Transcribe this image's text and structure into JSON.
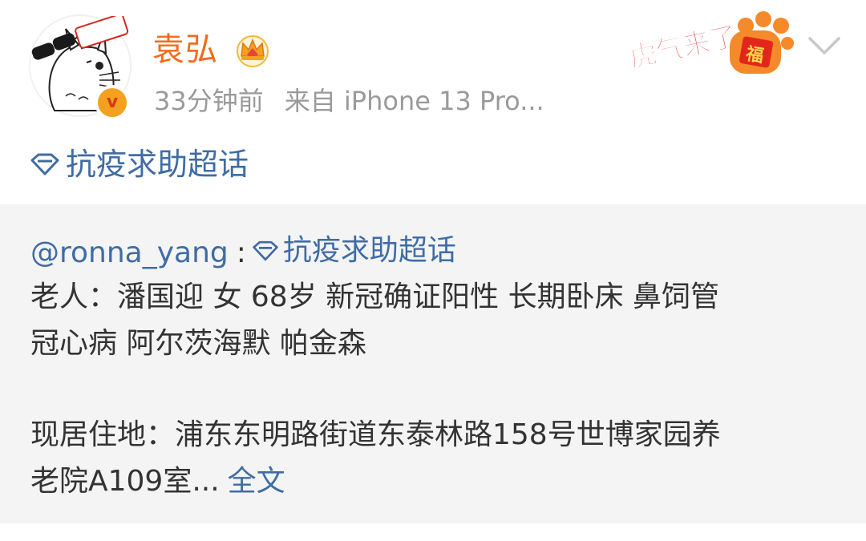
{
  "post": {
    "author_name": "袁弘",
    "timestamp": "33分钟前",
    "source": "来自 iPhone 13 Pro...",
    "topic": "抗疫求助超话",
    "sticker_text": "虎气来了",
    "sticker_badge": "福"
  },
  "repost": {
    "mention": "@ronna_yang",
    "colon": ":",
    "topic": "抗疫求助超话",
    "line2": "老人：潘国迎 女 68岁 新冠确证阳性 长期卧床 鼻饲管",
    "line3": "冠心病  阿尔茨海默 帕金森",
    "line5": "现居住地：浦东东明路街道东泰林路158号世博家园养",
    "line6": "老院A109室...",
    "more_label": "全文"
  },
  "colors": {
    "username": "#f26b1d",
    "link": "#3f6ca4",
    "meta": "#9a9a9a",
    "repost_bg": "#f4f4f4",
    "verified": "#f3a11f"
  },
  "icons": {
    "avatar": "totoro-avatar",
    "verified": "verified-badge-icon",
    "vip": "crown-icon",
    "topic": "diamond-icon",
    "menu": "chevron-down-icon"
  }
}
